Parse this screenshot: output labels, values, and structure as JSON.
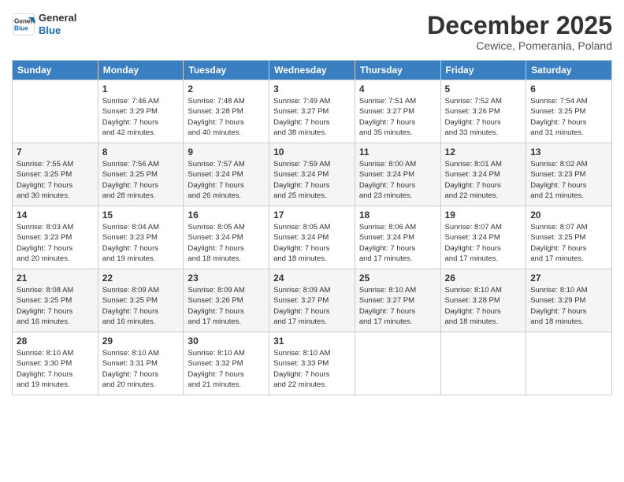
{
  "header": {
    "logo_line1": "General",
    "logo_line2": "Blue",
    "month_title": "December 2025",
    "location": "Cewice, Pomerania, Poland"
  },
  "days_of_week": [
    "Sunday",
    "Monday",
    "Tuesday",
    "Wednesday",
    "Thursday",
    "Friday",
    "Saturday"
  ],
  "weeks": [
    [
      {
        "day": "",
        "info": ""
      },
      {
        "day": "1",
        "info": "Sunrise: 7:46 AM\nSunset: 3:29 PM\nDaylight: 7 hours\nand 42 minutes."
      },
      {
        "day": "2",
        "info": "Sunrise: 7:48 AM\nSunset: 3:28 PM\nDaylight: 7 hours\nand 40 minutes."
      },
      {
        "day": "3",
        "info": "Sunrise: 7:49 AM\nSunset: 3:27 PM\nDaylight: 7 hours\nand 38 minutes."
      },
      {
        "day": "4",
        "info": "Sunrise: 7:51 AM\nSunset: 3:27 PM\nDaylight: 7 hours\nand 35 minutes."
      },
      {
        "day": "5",
        "info": "Sunrise: 7:52 AM\nSunset: 3:26 PM\nDaylight: 7 hours\nand 33 minutes."
      },
      {
        "day": "6",
        "info": "Sunrise: 7:54 AM\nSunset: 3:25 PM\nDaylight: 7 hours\nand 31 minutes."
      }
    ],
    [
      {
        "day": "7",
        "info": "Sunrise: 7:55 AM\nSunset: 3:25 PM\nDaylight: 7 hours\nand 30 minutes."
      },
      {
        "day": "8",
        "info": "Sunrise: 7:56 AM\nSunset: 3:25 PM\nDaylight: 7 hours\nand 28 minutes."
      },
      {
        "day": "9",
        "info": "Sunrise: 7:57 AM\nSunset: 3:24 PM\nDaylight: 7 hours\nand 26 minutes."
      },
      {
        "day": "10",
        "info": "Sunrise: 7:59 AM\nSunset: 3:24 PM\nDaylight: 7 hours\nand 25 minutes."
      },
      {
        "day": "11",
        "info": "Sunrise: 8:00 AM\nSunset: 3:24 PM\nDaylight: 7 hours\nand 23 minutes."
      },
      {
        "day": "12",
        "info": "Sunrise: 8:01 AM\nSunset: 3:24 PM\nDaylight: 7 hours\nand 22 minutes."
      },
      {
        "day": "13",
        "info": "Sunrise: 8:02 AM\nSunset: 3:23 PM\nDaylight: 7 hours\nand 21 minutes."
      }
    ],
    [
      {
        "day": "14",
        "info": "Sunrise: 8:03 AM\nSunset: 3:23 PM\nDaylight: 7 hours\nand 20 minutes."
      },
      {
        "day": "15",
        "info": "Sunrise: 8:04 AM\nSunset: 3:23 PM\nDaylight: 7 hours\nand 19 minutes."
      },
      {
        "day": "16",
        "info": "Sunrise: 8:05 AM\nSunset: 3:24 PM\nDaylight: 7 hours\nand 18 minutes."
      },
      {
        "day": "17",
        "info": "Sunrise: 8:05 AM\nSunset: 3:24 PM\nDaylight: 7 hours\nand 18 minutes."
      },
      {
        "day": "18",
        "info": "Sunrise: 8:06 AM\nSunset: 3:24 PM\nDaylight: 7 hours\nand 17 minutes."
      },
      {
        "day": "19",
        "info": "Sunrise: 8:07 AM\nSunset: 3:24 PM\nDaylight: 7 hours\nand 17 minutes."
      },
      {
        "day": "20",
        "info": "Sunrise: 8:07 AM\nSunset: 3:25 PM\nDaylight: 7 hours\nand 17 minutes."
      }
    ],
    [
      {
        "day": "21",
        "info": "Sunrise: 8:08 AM\nSunset: 3:25 PM\nDaylight: 7 hours\nand 16 minutes."
      },
      {
        "day": "22",
        "info": "Sunrise: 8:09 AM\nSunset: 3:25 PM\nDaylight: 7 hours\nand 16 minutes."
      },
      {
        "day": "23",
        "info": "Sunrise: 8:09 AM\nSunset: 3:26 PM\nDaylight: 7 hours\nand 17 minutes."
      },
      {
        "day": "24",
        "info": "Sunrise: 8:09 AM\nSunset: 3:27 PM\nDaylight: 7 hours\nand 17 minutes."
      },
      {
        "day": "25",
        "info": "Sunrise: 8:10 AM\nSunset: 3:27 PM\nDaylight: 7 hours\nand 17 minutes."
      },
      {
        "day": "26",
        "info": "Sunrise: 8:10 AM\nSunset: 3:28 PM\nDaylight: 7 hours\nand 18 minutes."
      },
      {
        "day": "27",
        "info": "Sunrise: 8:10 AM\nSunset: 3:29 PM\nDaylight: 7 hours\nand 18 minutes."
      }
    ],
    [
      {
        "day": "28",
        "info": "Sunrise: 8:10 AM\nSunset: 3:30 PM\nDaylight: 7 hours\nand 19 minutes."
      },
      {
        "day": "29",
        "info": "Sunrise: 8:10 AM\nSunset: 3:31 PM\nDaylight: 7 hours\nand 20 minutes."
      },
      {
        "day": "30",
        "info": "Sunrise: 8:10 AM\nSunset: 3:32 PM\nDaylight: 7 hours\nand 21 minutes."
      },
      {
        "day": "31",
        "info": "Sunrise: 8:10 AM\nSunset: 3:33 PM\nDaylight: 7 hours\nand 22 minutes."
      },
      {
        "day": "",
        "info": ""
      },
      {
        "day": "",
        "info": ""
      },
      {
        "day": "",
        "info": ""
      }
    ]
  ]
}
